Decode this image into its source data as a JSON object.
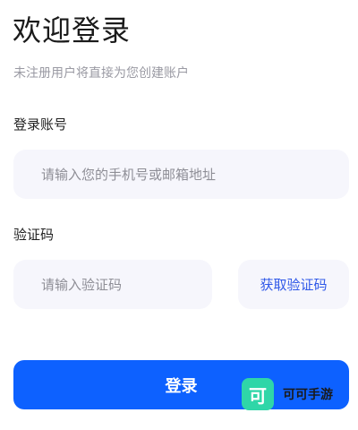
{
  "header": {
    "title": "欢迎登录",
    "subtitle": "未注册用户将直接为您创建账户"
  },
  "account": {
    "label": "登录账号",
    "placeholder": "请输入您的手机号或邮箱地址",
    "value": ""
  },
  "code": {
    "label": "验证码",
    "placeholder": "请输入验证码",
    "value": "",
    "get_code_label": "获取验证码"
  },
  "actions": {
    "login_label": "登录"
  },
  "watermark": {
    "logo_glyph": "可",
    "text": "可可手游"
  },
  "colors": {
    "primary": "#0d61ff",
    "link": "#2f58e8",
    "input_bg": "#f6f6fc",
    "watermark_logo": "#2fd6a8"
  }
}
